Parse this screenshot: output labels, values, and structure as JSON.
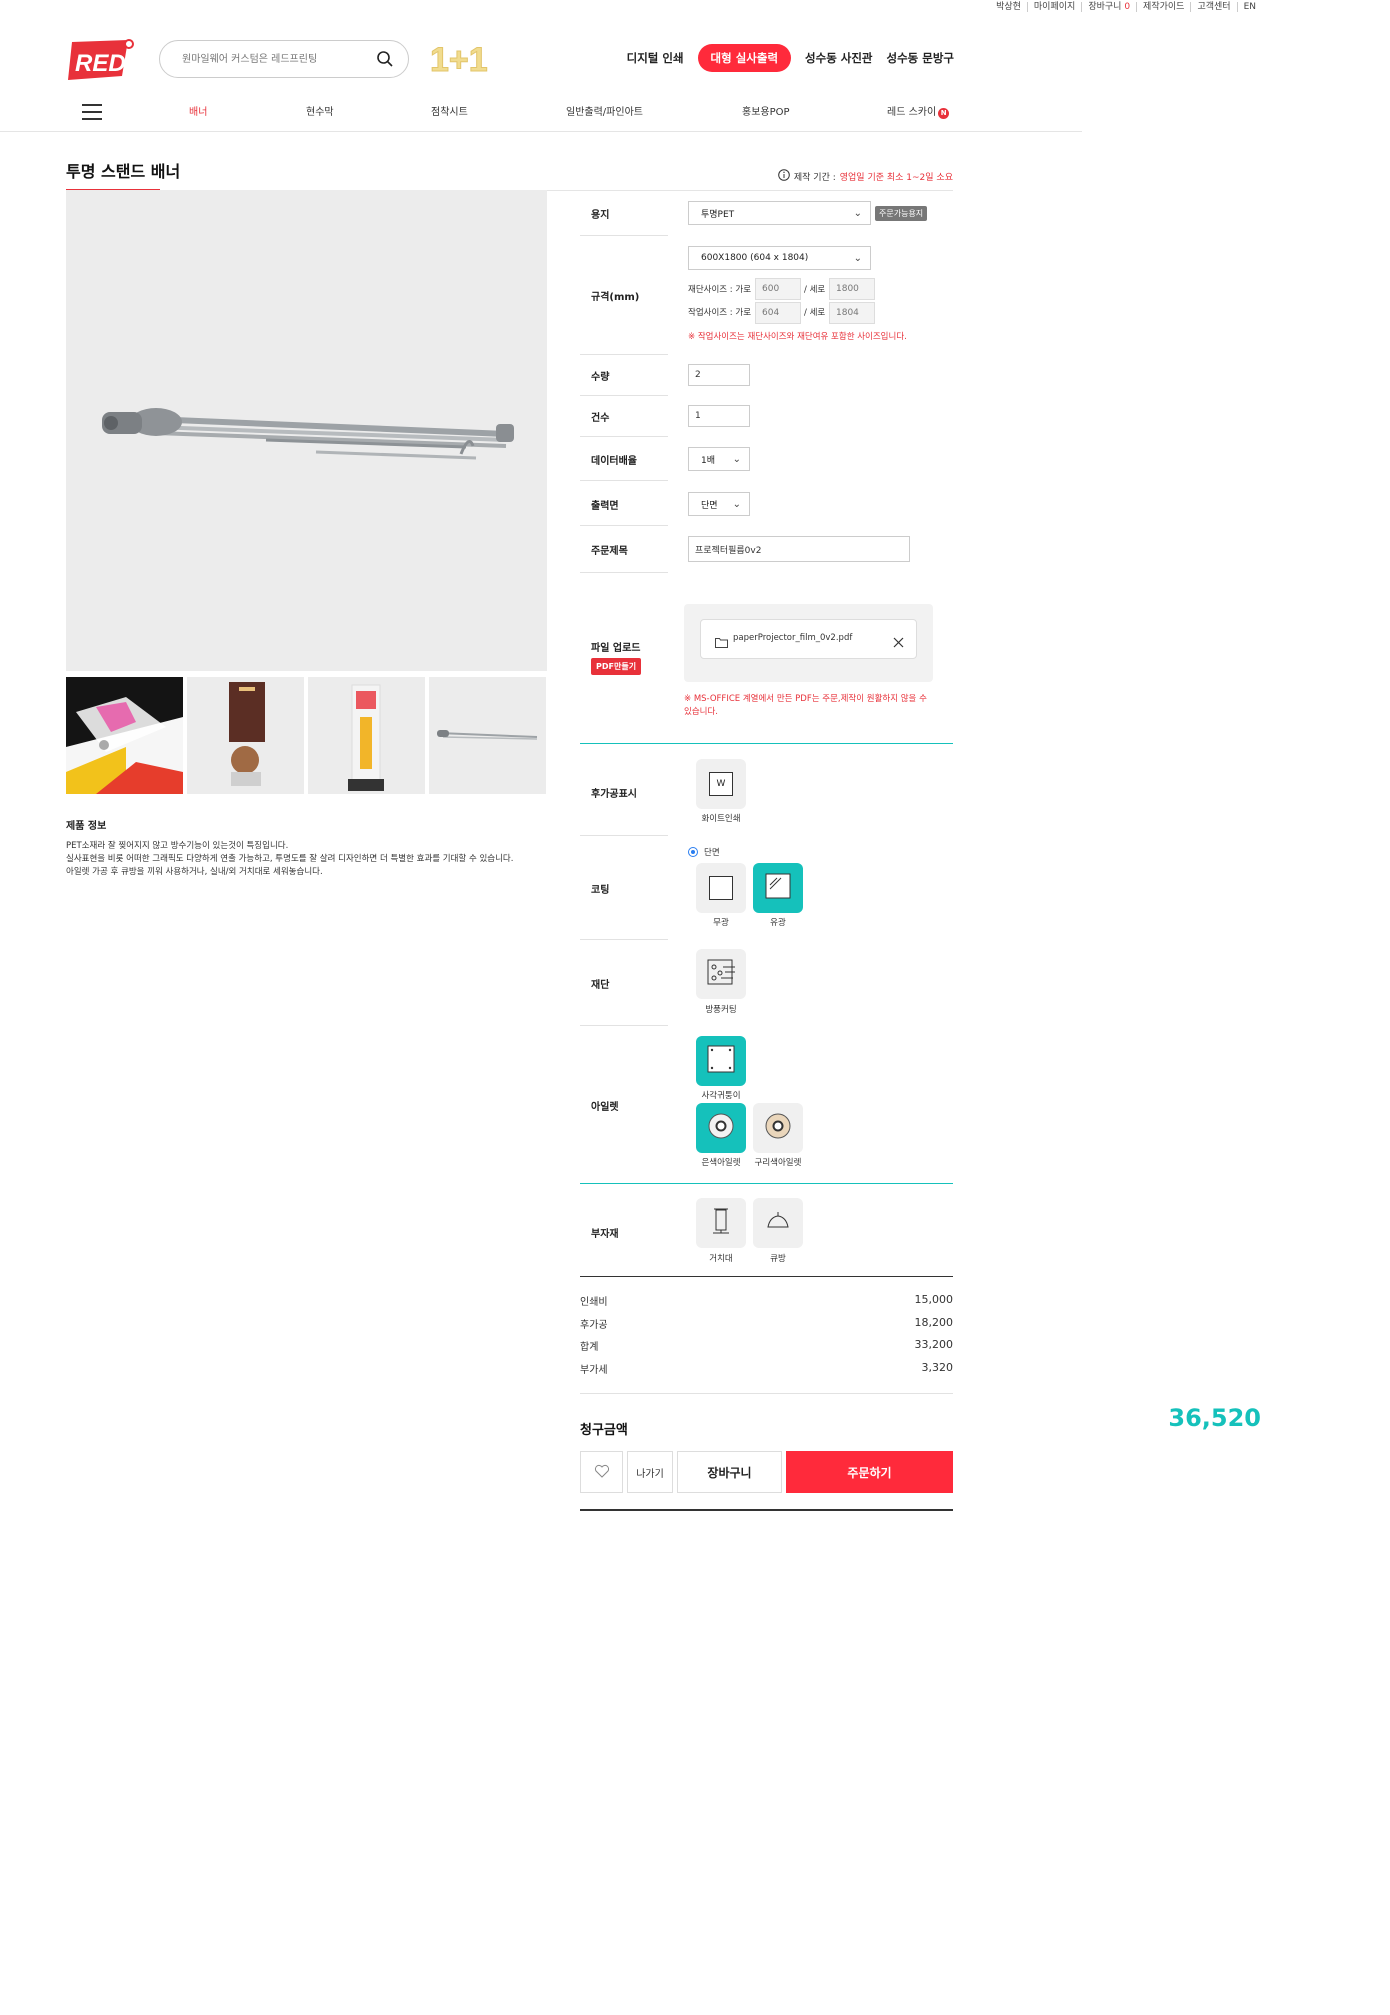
{
  "topbar": {
    "user": "박상현",
    "mypage": "마이페이지",
    "cart": "장바구니",
    "cart_count": "0",
    "guide": "제작가이드",
    "support": "고객센터",
    "lang": "EN"
  },
  "header": {
    "logo_text": "RED",
    "search_placeholder": "원마일웨어 커스텀은 레드프린팅",
    "promo_text": "1+1",
    "nav": [
      "디지털 인쇄",
      "대형 실사출력",
      "성수동 사진관",
      "성수동 문방구"
    ]
  },
  "categories": [
    "배너",
    "현수막",
    "점착시트",
    "일반출력/파인아트",
    "홍보용POP",
    "레드 스카이"
  ],
  "category_badge": "N",
  "page": {
    "title": "투명 스탠드 배너",
    "leadtime_label": "제작 기간 :",
    "leadtime_value": "영업일 기준 최소 1~2일 소요"
  },
  "product_info": {
    "title": "제품 정보",
    "lines": [
      "PET소재라 잘 찢어지지 않고 방수기능이 있는것이 특징입니다.",
      "실사표현을 비롯 어떠한 그래픽도 다양하게 연출 가능하고, 투명도를 잘 살려 디자인하면 더 특별한 효과를 기대할 수 있습니다.",
      "아일렛 가공 후 큐방을 끼워 사용하거나, 실내/외 거치대로 세워놓습니다."
    ]
  },
  "options": {
    "paper": {
      "label": "용지",
      "value": "투명PET",
      "badge": "주문가능용지"
    },
    "size": {
      "label": "규격(mm)",
      "value": "600X1800 (604 x 1804)",
      "cut_label": "재단사이즈 : 가로",
      "cut_w": "600",
      "cut_h_label": "/ 세로",
      "cut_h": "1800",
      "work_label": "작업사이즈 : 가로",
      "work_w": "604",
      "work_h_label": "/ 세로",
      "work_h": "1804",
      "note": "※ 작업사이즈는 재단사이즈와 재단여유 포함한 사이즈입니다."
    },
    "qty": {
      "label": "수량",
      "value": "2"
    },
    "count": {
      "label": "건수",
      "value": "1"
    },
    "scale": {
      "label": "데이터배율",
      "value": "1배"
    },
    "side": {
      "label": "출력면",
      "value": "단면"
    },
    "order_title": {
      "label": "주문제목",
      "value": "프로젝터필름0v2"
    },
    "upload": {
      "label": "파일 업로드",
      "pdf_badge": "PDF만들기",
      "file_name": "paperProjector_film_0v2.pdf",
      "note_line1": "※ MS-OFFICE 계열에서 만든 PDF는 주문,제작이 원활하지 않을 수",
      "note_line2": "있습니다."
    }
  },
  "finishing": {
    "post_label": {
      "label": "후가공표시",
      "items": [
        {
          "name": "화이트인쇄",
          "glyph": "W"
        }
      ]
    },
    "coating": {
      "label": "코팅",
      "radio": "단면",
      "items": [
        "무광",
        "유광"
      ]
    },
    "cutting": {
      "label": "재단",
      "items": [
        "방풍커팅"
      ]
    },
    "eyelet": {
      "label": "아일렛",
      "items": [
        "사각귀퉁이",
        "은색아일렛",
        "구리색아일렛"
      ]
    },
    "accessory": {
      "label": "부자재",
      "items": [
        "거치대",
        "큐방"
      ]
    }
  },
  "pricing": {
    "rows": [
      {
        "label": "인쇄비",
        "value": "15,000"
      },
      {
        "label": "후가공",
        "value": "18,200"
      },
      {
        "label": "합계",
        "value": "33,200"
      },
      {
        "label": "부가세",
        "value": "3,320"
      }
    ],
    "total_label": "청구금액",
    "total_value": "36,520"
  },
  "actions": {
    "exit": "나가기",
    "cart": "장바구니",
    "order": "주문하기"
  },
  "colors": {
    "brand_red": "#e8313a",
    "accent_teal": "#15c1bb",
    "cta_red": "#ff2a3b"
  }
}
